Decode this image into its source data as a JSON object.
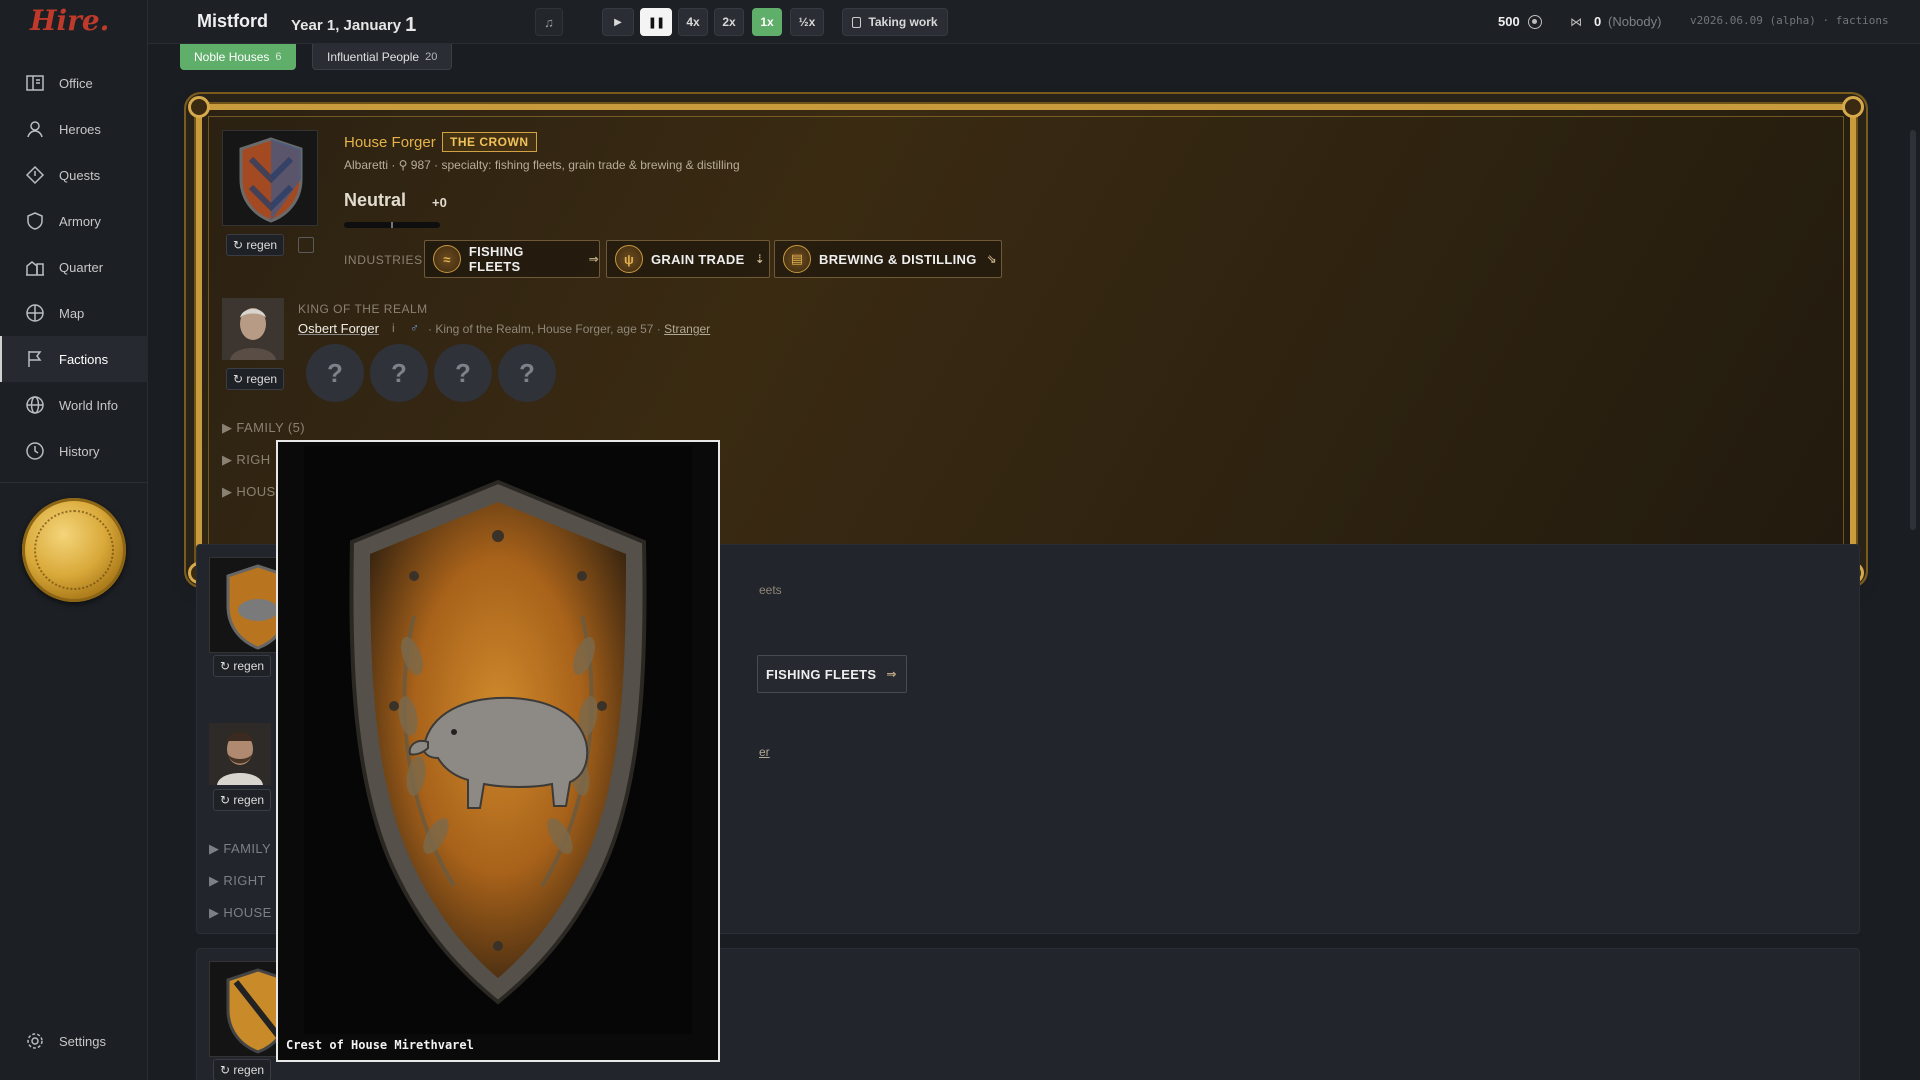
{
  "app": {
    "logo": "Hire."
  },
  "topbar": {
    "city": "Mistford",
    "date_prefix": "Year 1, January",
    "date_day": "1",
    "music_icon": "music-note-icon",
    "speed_buttons": [
      "4x",
      "2x",
      "1x",
      "½x"
    ],
    "active_speed": "1x",
    "taking_work": "Taking work",
    "gold": "500",
    "crowd_count": "0",
    "crowd_who": "(Nobody)",
    "version": "v2026.06.09 (alpha) · factions"
  },
  "sidebar": {
    "items": [
      {
        "label": "Office",
        "icon": "office-icon"
      },
      {
        "label": "Heroes",
        "icon": "person-icon"
      },
      {
        "label": "Quests",
        "icon": "diamond-icon"
      },
      {
        "label": "Armory",
        "icon": "shield-icon"
      },
      {
        "label": "Quarter",
        "icon": "buildings-icon"
      },
      {
        "label": "Map",
        "icon": "compass-icon"
      },
      {
        "label": "Factions",
        "icon": "flag-icon"
      },
      {
        "label": "World Info",
        "icon": "globe-icon"
      },
      {
        "label": "History",
        "icon": "clock-icon"
      }
    ],
    "active": "Factions",
    "settings": "Settings"
  },
  "tabs": [
    {
      "label": "Noble Houses",
      "count": "6"
    },
    {
      "label": "Influential People",
      "count": "20"
    }
  ],
  "crown_house": {
    "name": "House Forger",
    "badge": "THE CROWN",
    "subtitle": "Albaretti · ⚲ 987 · specialty: fishing fleets, grain trade & brewing & distilling",
    "stance": "Neutral",
    "stance_value": "+0",
    "stance_level": 0,
    "regen": "↻ regen",
    "industries_label": "INDUSTRIES",
    "industries": [
      {
        "label": "FISHING FLEETS",
        "tail": "⇒"
      },
      {
        "label": "GRAIN TRADE",
        "tail": "⇣"
      },
      {
        "label": "BREWING & DISTILLING",
        "tail": "⇘"
      }
    ],
    "leader_title": "KING OF THE REALM",
    "leader_name": "Osbert Forger",
    "leader_info_icon": "i",
    "leader_gender": "♂",
    "leader_desc": "· King of the Realm, House Forger, age 57 ·",
    "leader_relation": "Stranger",
    "unknown_slots": [
      "?",
      "?",
      "?",
      "?"
    ],
    "sections": [
      "▶ FAMILY (5)",
      "▶ RIGH",
      "▶ HOUS"
    ]
  },
  "second_house": {
    "regen": "↻ regen",
    "specialty_fragment": "eets",
    "industry_chip": "FISHING FLEETS",
    "industry_tail": "⇒",
    "relation_fragment": "er",
    "sections": [
      "▶ FAMILY",
      "▶ RIGHT",
      "▶ HOUSE"
    ]
  },
  "third_house": {
    "regen": "↻ regen"
  },
  "popup": {
    "caption": "Crest of House Mirethvarel"
  },
  "colors": {
    "accent_gold": "#c89b3c",
    "active_green": "#5fae6a"
  }
}
